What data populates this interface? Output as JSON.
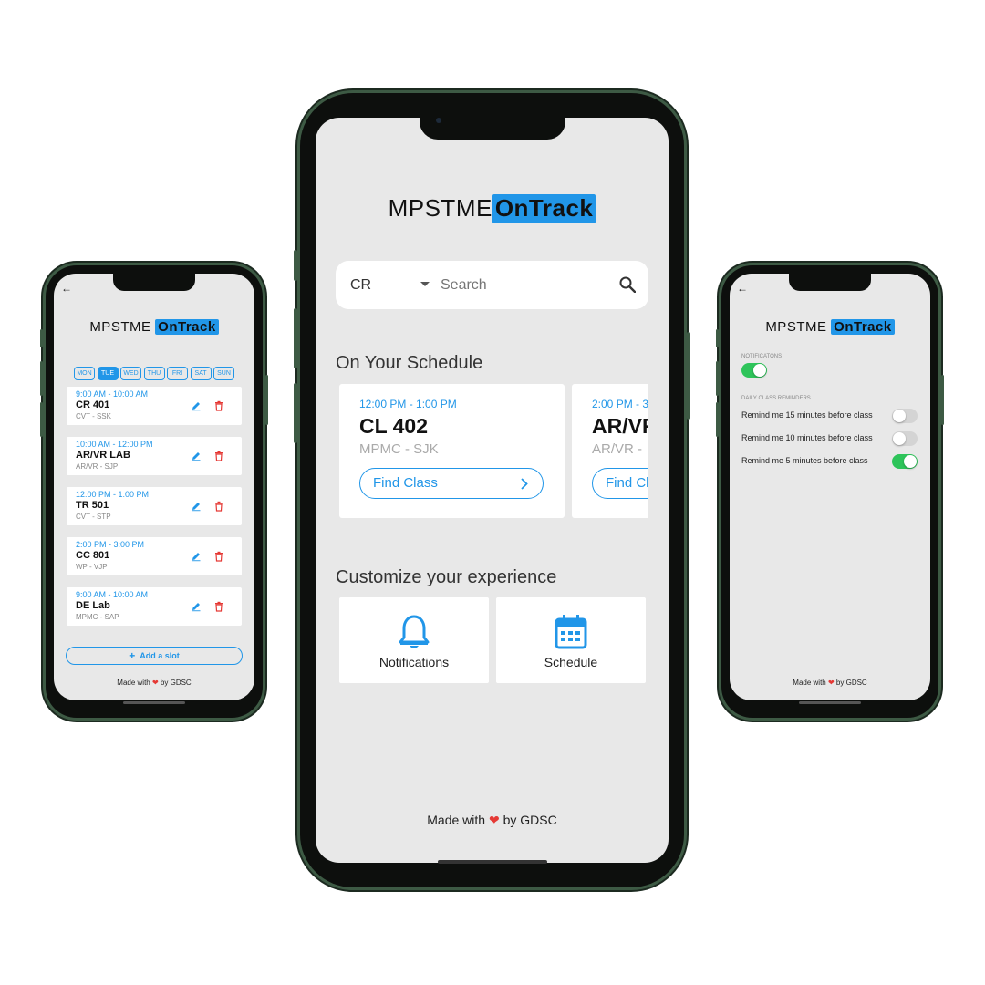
{
  "brand": {
    "prefix": "MPSTME",
    "highlight": "OnTrack"
  },
  "left_phone": {
    "back": "←",
    "days": [
      {
        "label": "MON",
        "active": false
      },
      {
        "label": "TUE",
        "active": true
      },
      {
        "label": "WED",
        "active": false
      },
      {
        "label": "THU",
        "active": false
      },
      {
        "label": "FRI",
        "active": false
      },
      {
        "label": "SAT",
        "active": false
      },
      {
        "label": "SUN",
        "active": false
      }
    ],
    "slots": [
      {
        "time": "9:00 AM - 10:00 AM",
        "course": "CR 401",
        "sub": "CVT - SSK"
      },
      {
        "time": "10:00 AM - 12:00 PM",
        "course": "AR/VR LAB",
        "sub": "AR/VR - SJP"
      },
      {
        "time": "12:00 PM - 1:00 PM",
        "course": "TR 501",
        "sub": "CVT - STP"
      },
      {
        "time": "2:00 PM - 3:00 PM",
        "course": "CC 801",
        "sub": "WP - VJP"
      },
      {
        "time": "9:00 AM - 10:00 AM",
        "course": "DE Lab",
        "sub": "MPMC - SAP"
      }
    ],
    "add_slot": "Add a slot",
    "footer": {
      "before": "Made with",
      "after": "by GDSC"
    }
  },
  "main_phone": {
    "search": {
      "selector": "CR",
      "placeholder": "Search"
    },
    "schedule_title": "On Your Schedule",
    "schedule": [
      {
        "time": "12:00 PM - 1:00 PM",
        "course": "CL 402",
        "sub": "MPMC - SJK",
        "button": "Find Class"
      },
      {
        "time": "2:00 PM - 3",
        "course": "AR/VR",
        "sub": "AR/VR -",
        "button": "Find Cl"
      }
    ],
    "customize_title": "Customize your experience",
    "tiles": [
      {
        "label": "Notifications",
        "icon": "bell-icon"
      },
      {
        "label": "Schedule",
        "icon": "calendar-icon"
      }
    ],
    "footer": {
      "before": "Made with",
      "after": "by GDSC"
    }
  },
  "right_phone": {
    "back": "←",
    "notifications_label": "NOTIFICATONS",
    "notifications_on": true,
    "reminders_label": "DAILY CLASS REMINDERS",
    "reminders": [
      {
        "label": "Remind me 15 minutes before class",
        "on": false
      },
      {
        "label": "Remind me 10 minutes before class",
        "on": false
      },
      {
        "label": "Remind me 5 minutes before class",
        "on": true
      }
    ],
    "footer": {
      "before": "Made with",
      "after": "by GDSC"
    }
  },
  "colors": {
    "accent": "#2196e8",
    "danger": "#e53935",
    "toggle_on": "#2ec45a",
    "heart": "#e53935",
    "screen_bg": "#e8e8e8"
  }
}
